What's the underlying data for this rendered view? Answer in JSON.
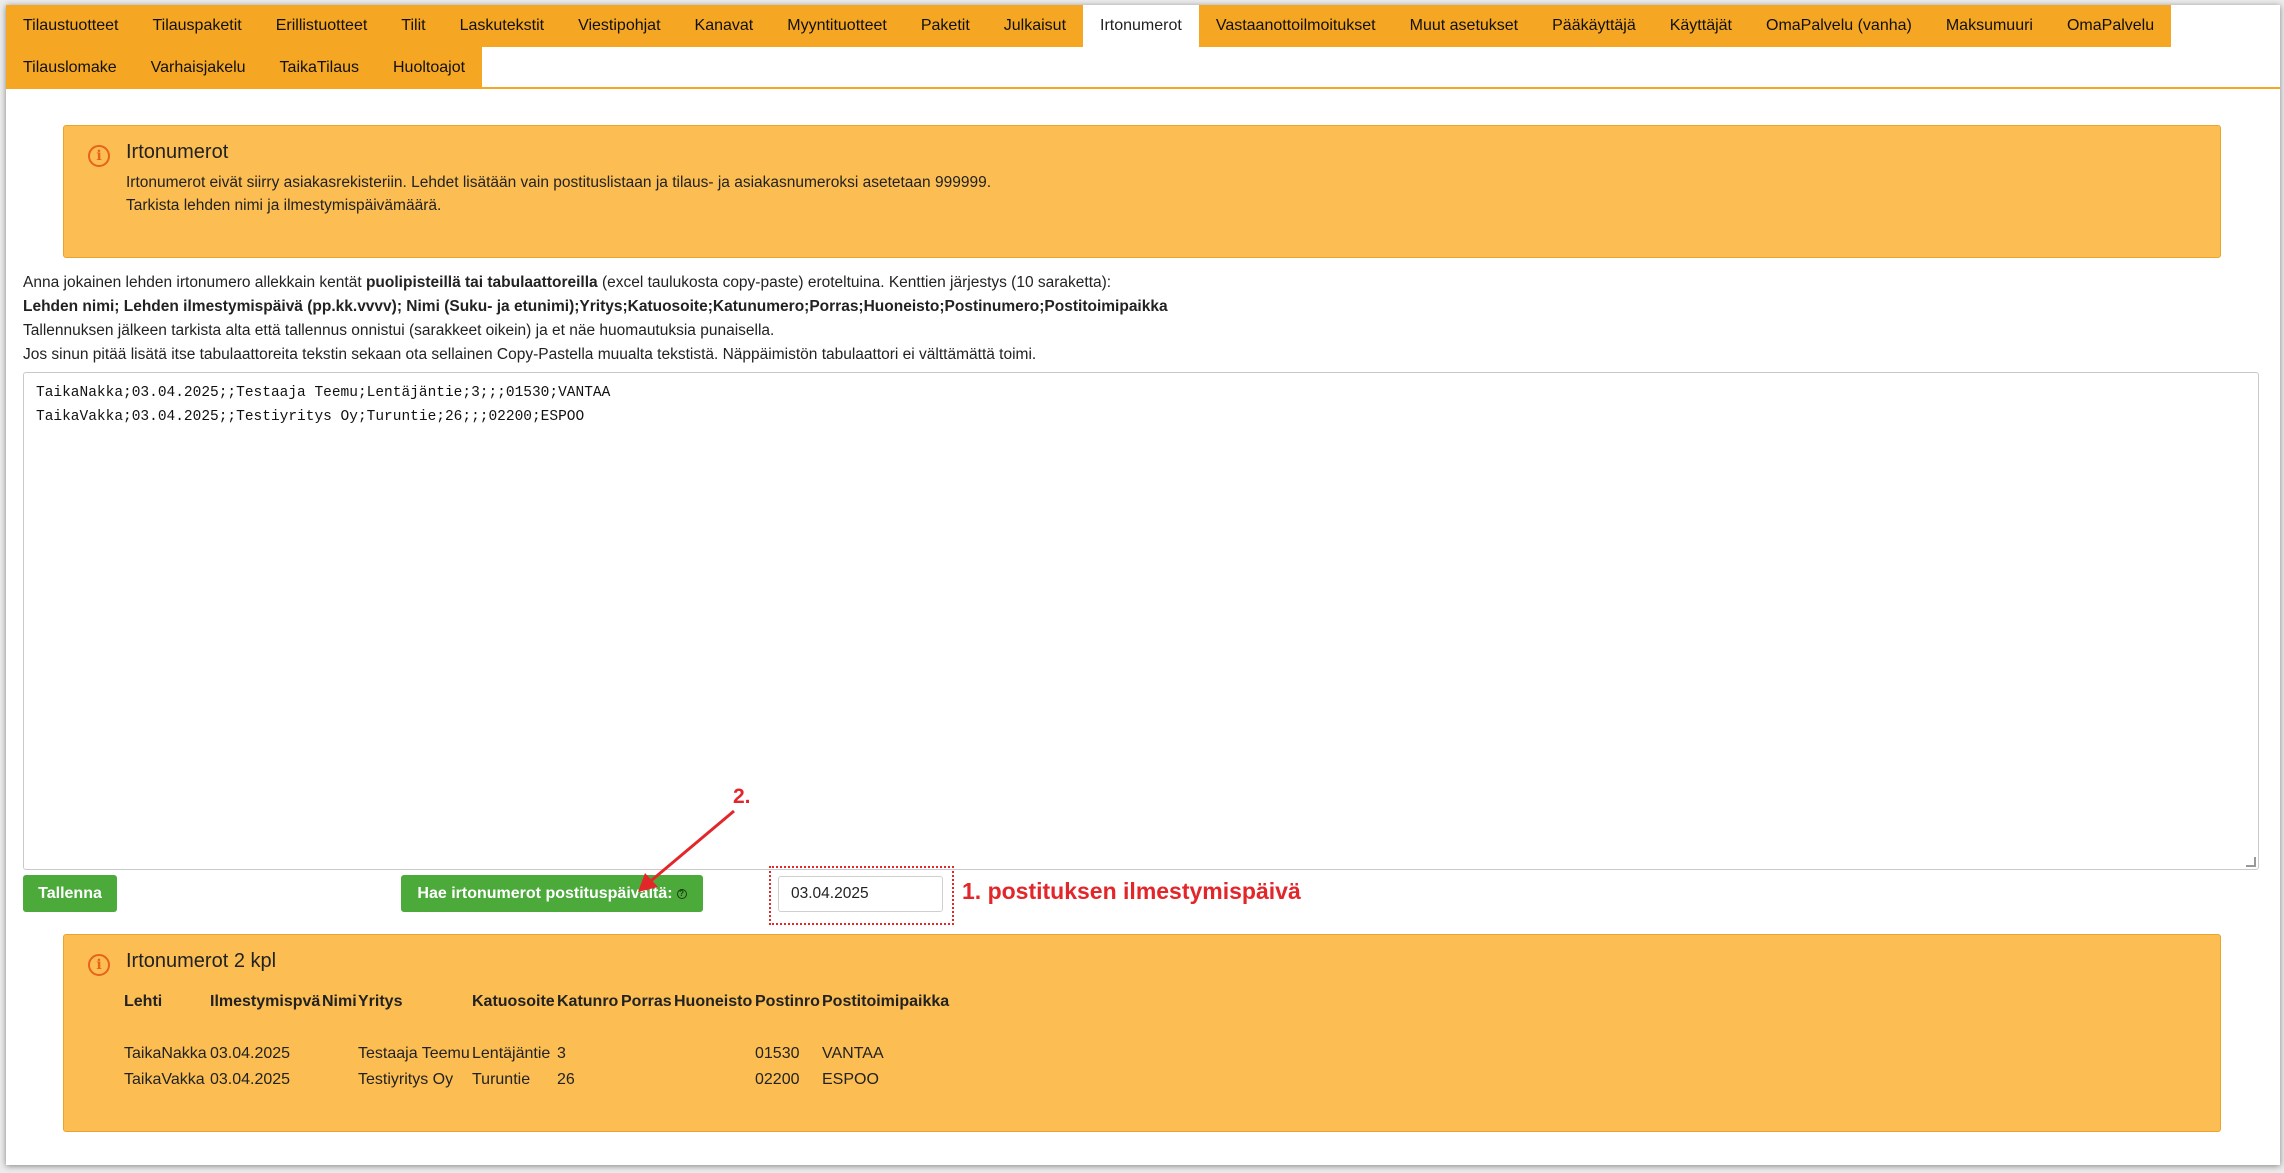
{
  "tabs_row1": [
    "Tilaustuotteet",
    "Tilauspaketit",
    "Erillistuotteet",
    "Tilit",
    "Laskutekstit",
    "Viestipohjat",
    "Kanavat",
    "Myyntituotteet",
    "Paketit",
    "Julkaisut",
    "Irtonumerot",
    "Vastaanottoilmoitukset",
    "Muut asetukset",
    "Pääkäyttäjä",
    "Käyttäjät",
    "OmaPalvelu (vanha)",
    "Maksumuuri",
    "OmaPalvelu"
  ],
  "tabs_row2": [
    "Tilauslomake",
    "Varhaisjakelu",
    "TaikaTilaus",
    "Huoltoajot"
  ],
  "active_tab": "Irtonumerot",
  "info_alert": {
    "icon": "info-icon",
    "title": "Irtonumerot",
    "line1": "Irtonumerot eivät siirry asiakasrekisteriin. Lehdet lisätään vain postituslistaan ja tilaus- ja asiakasnumeroksi asetetaan 999999.",
    "line2": "Tarkista lehden nimi ja ilmestymispäivämäärä."
  },
  "instructions": {
    "line1_a": "Anna jokainen lehden irtonumero allekkain kentät ",
    "line1_bold": "puolipisteillä tai tabulaattoreilla",
    "line1_b": " (excel taulukosta copy-paste) eroteltuina. Kenttien järjestys (10 saraketta):",
    "line2_bold": "Lehden nimi; Lehden ilmestymispäivä (pp.kk.vvvv); Nimi (Suku- ja etunimi);Yritys;Katuosoite;Katunumero;Porras;Huoneisto;Postinumero;Postitoimipaikka",
    "line3": "Tallennuksen jälkeen tarkista alta että tallennus onnistui (sarakkeet oikein) ja et näe huomautuksia punaisella.",
    "line4": "Jos sinun pitää lisätä itse tabulaattoreita tekstin sekaan ota sellainen Copy-Pastella muualta tekstistä. Näppäimistön tabulaattori ei välttämättä toimi."
  },
  "textarea_lines": [
    "TaikaNakka;03.04.2025;;Testaaja Teemu;Lentäjäntie;3;;;01530;VANTAA",
    "TaikaVakka;03.04.2025;;Testiyritys Oy;Turuntie;26;;;02200;ESPOO"
  ],
  "buttons": {
    "save": "Tallenna",
    "fetch": "Hae irtonumerot postituspäivältä:",
    "fetch_help_icon": "question-circle-icon"
  },
  "date_input_value": "03.04.2025",
  "annotations": {
    "step1": "1. postituksen ilmestymispäivä",
    "step2": "2."
  },
  "result_alert": {
    "icon": "info-icon",
    "title": "Irtonumerot 2 kpl",
    "columns": [
      "Lehti",
      "Ilmestymispvä",
      "Nimi",
      "Yritys",
      "Katuosoite",
      "Katunro",
      "Porras",
      "Huoneisto",
      "Postinro",
      "Postitoimipaikka"
    ],
    "rows": [
      [
        "TaikaNakka",
        "03.04.2025",
        "",
        "Testaaja Teemu",
        "Lentäjäntie",
        "3",
        "",
        "",
        "01530",
        "VANTAA"
      ],
      [
        "TaikaVakka",
        "03.04.2025",
        "",
        "Testiyritys Oy",
        "Turuntie",
        "26",
        "",
        "",
        "02200",
        "ESPOO"
      ]
    ]
  },
  "colors": {
    "tab_orange": "#f5a623",
    "alert_bg": "#fcbe52",
    "button_green": "#4caa3b",
    "annotation_red": "#e3262a"
  }
}
